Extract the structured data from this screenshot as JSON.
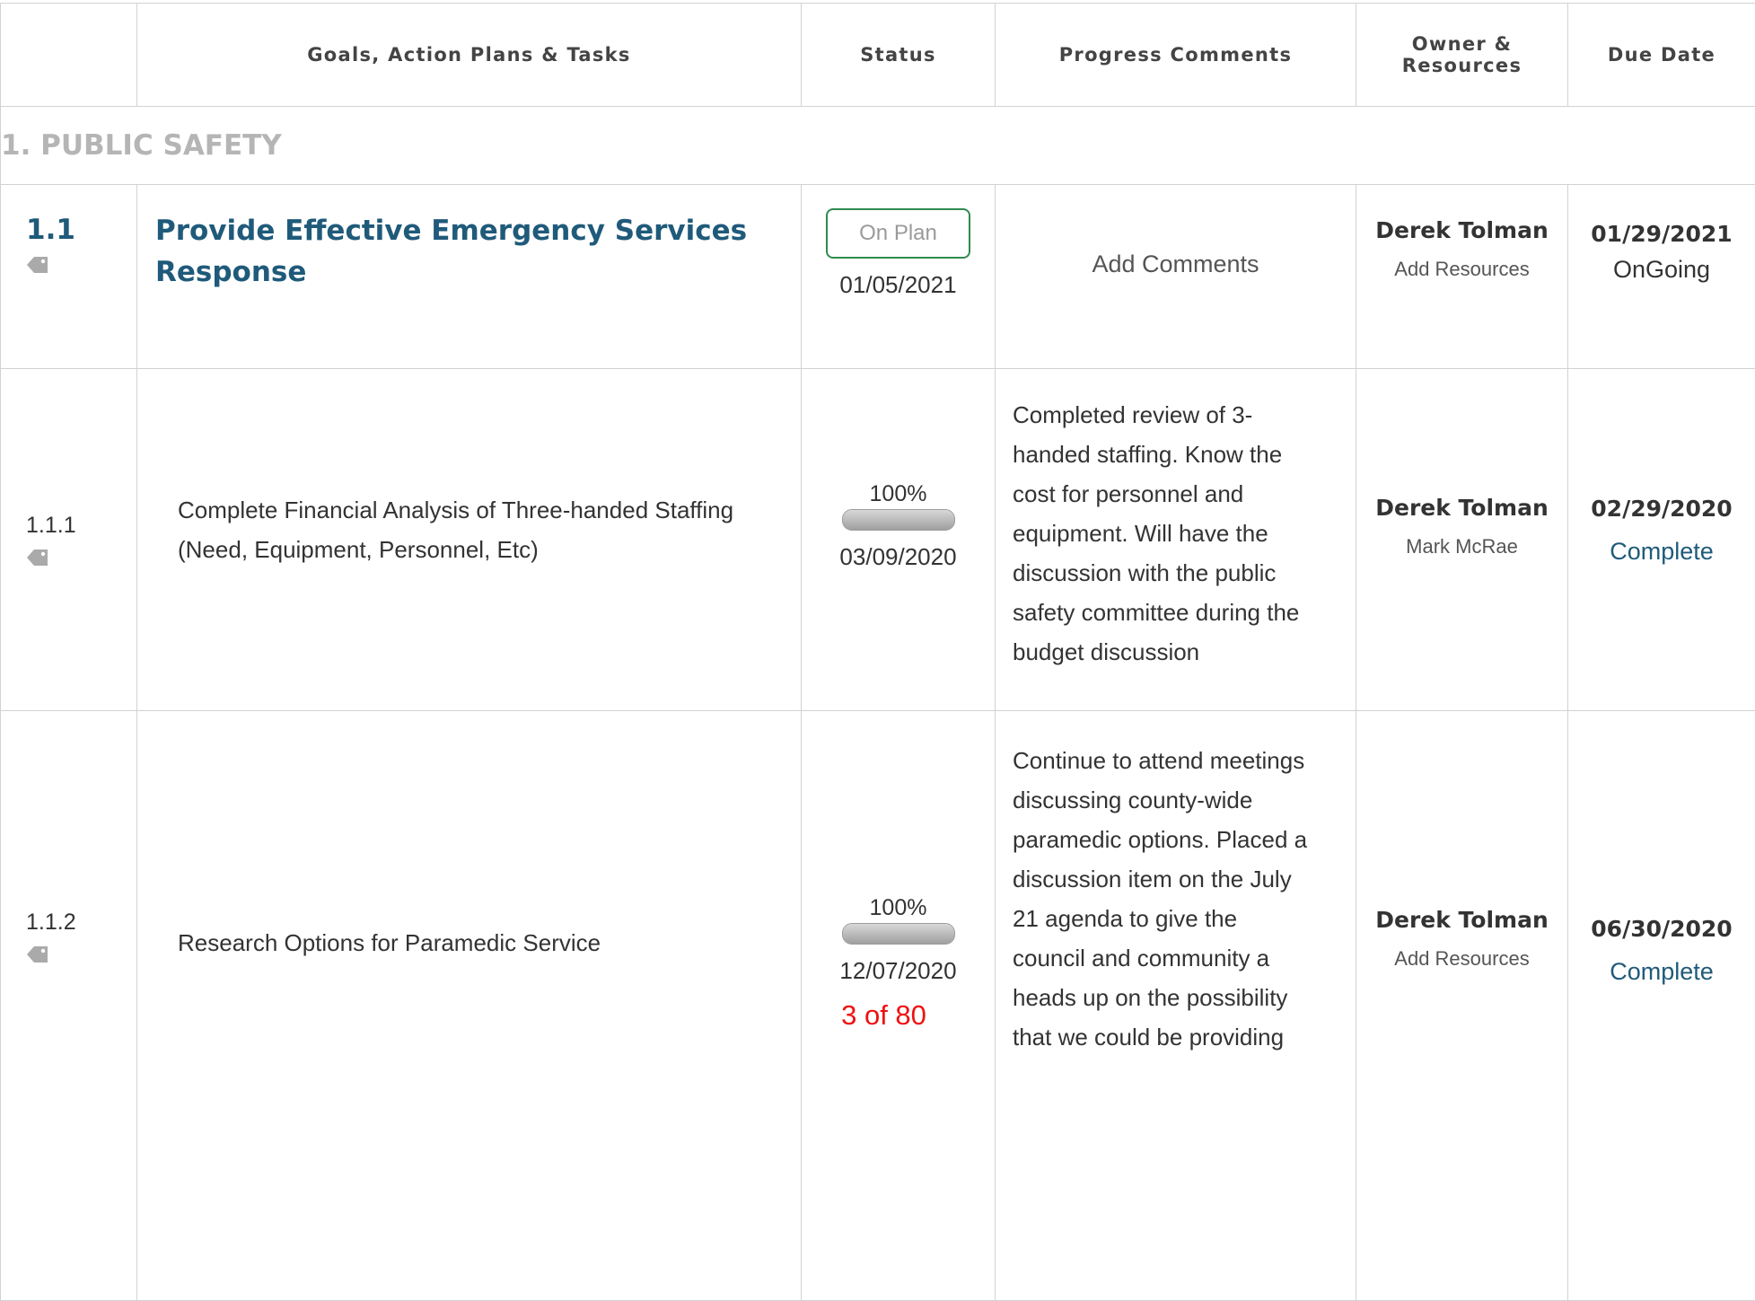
{
  "headers": {
    "col_id": "",
    "col_goals": "Goals, Action Plans & Tasks",
    "col_status": "Status",
    "col_comments": "Progress Comments",
    "col_owner_line1": "Owner &",
    "col_owner_line2": "Resources",
    "col_due": "Due Date"
  },
  "section": {
    "title": "1. PUBLIC SAFETY"
  },
  "rows": [
    {
      "id": "1.1",
      "title_line1": "Provide Effective Emergency Services",
      "title_line2": "Response",
      "status_badge": "On Plan",
      "status_date": "01/05/2021",
      "comment": "Add Comments",
      "owner": "Derek Tolman",
      "resource": "Add Resources",
      "due_date": "01/29/2021",
      "state": "OnGoing"
    },
    {
      "id": "1.1.1",
      "title_line1": "Complete Financial Analysis of Three-handed Staffing",
      "title_line2": "(Need, Equipment, Personnel, Etc)",
      "progress_label": "100%",
      "progress": 1.0,
      "status_date": "03/09/2020",
      "comment_lines": [
        "Completed review of 3-",
        "handed staffing. Know the",
        "cost for personnel and",
        "equipment. Will have the",
        "discussion with the public",
        "safety committee during the",
        "budget discussion"
      ],
      "owner": "Derek Tolman",
      "resource": "Mark McRae",
      "due_date": "02/29/2020",
      "state": "Complete"
    },
    {
      "id": "1.1.2",
      "title_line1": "Research Options for Paramedic Service",
      "progress_label": "100%",
      "progress": 1.0,
      "status_date": "12/07/2020",
      "count_label": "3 of 80",
      "comment_lines": [
        "Continue to attend meetings",
        "discussing county-wide",
        "paramedic options. Placed a",
        "discussion item on the July",
        "21 agenda to give the",
        "council and community a",
        "heads up on the possibility",
        "that we could be providing"
      ],
      "owner": "Derek Tolman",
      "resource": "Add Resources",
      "due_date": "06/30/2020",
      "state": "Complete"
    }
  ],
  "colors": {
    "accent_blue": "#1f5a7a",
    "section_border": "#5bbcd6",
    "on_plan_border": "#2e8b4f",
    "count_red": "#ee1111",
    "grid_line": "#d2d2d2"
  },
  "icons": {
    "row_tag": "tag-icon"
  }
}
